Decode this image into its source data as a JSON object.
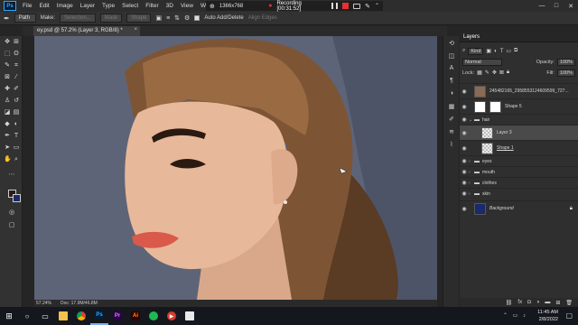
{
  "menubar": {
    "logo": "Ps",
    "items": [
      "File",
      "Edit",
      "Image",
      "Layer",
      "Type",
      "Select",
      "Filter",
      "3D",
      "View",
      "Window"
    ]
  },
  "recorder": {
    "resolution": "1366x768",
    "status": "Recording [00:31:52]"
  },
  "window_controls": [
    "—",
    "□",
    "✕"
  ],
  "options_bar": {
    "mode": "Path",
    "make_label": "Make:",
    "selection": "Selection...",
    "mask": "Mask",
    "shape": "Shape",
    "auto_add_delete": "Auto Add/Delete",
    "align_edges": "Align Edges"
  },
  "document": {
    "tab_title": "ey.psd @ 57.2% (Layer 3, RGB/8) *",
    "zoom": "57.24%",
    "doc_size": "Doc: 17.9M/46.8M"
  },
  "toolbar": {
    "foreground_color": "#2a1c15",
    "background_color": "#1a2a6a"
  },
  "layers_panel": {
    "title": "Layers",
    "filter_kind": "Kind",
    "blend_mode": "Normal",
    "opacity_label": "Opacity:",
    "opacity": "100%",
    "lock_label": "Lock:",
    "fill_label": "Fill:",
    "fill": "100%",
    "layers": [
      {
        "name": "245482165_2958553124609599_727...",
        "type": "image"
      },
      {
        "name": "Shape 5",
        "type": "shape"
      },
      {
        "name": "hair",
        "type": "group"
      },
      {
        "name": "Layer 3",
        "type": "layer",
        "selected": true
      },
      {
        "name": "Shape 1",
        "type": "shape"
      },
      {
        "name": "eyes",
        "type": "group"
      },
      {
        "name": "mouth",
        "type": "group"
      },
      {
        "name": "clothes",
        "type": "group"
      },
      {
        "name": "skin",
        "type": "group"
      },
      {
        "name": "Background",
        "type": "fill"
      }
    ]
  },
  "taskbar": {
    "time": "11:45 AM",
    "date": "2/8/2022",
    "apps": [
      "start",
      "search",
      "task-view",
      "file-explorer",
      "chrome",
      "photoshop",
      "premiere",
      "illustrator",
      "spotify",
      "media-player",
      "notepad"
    ]
  }
}
